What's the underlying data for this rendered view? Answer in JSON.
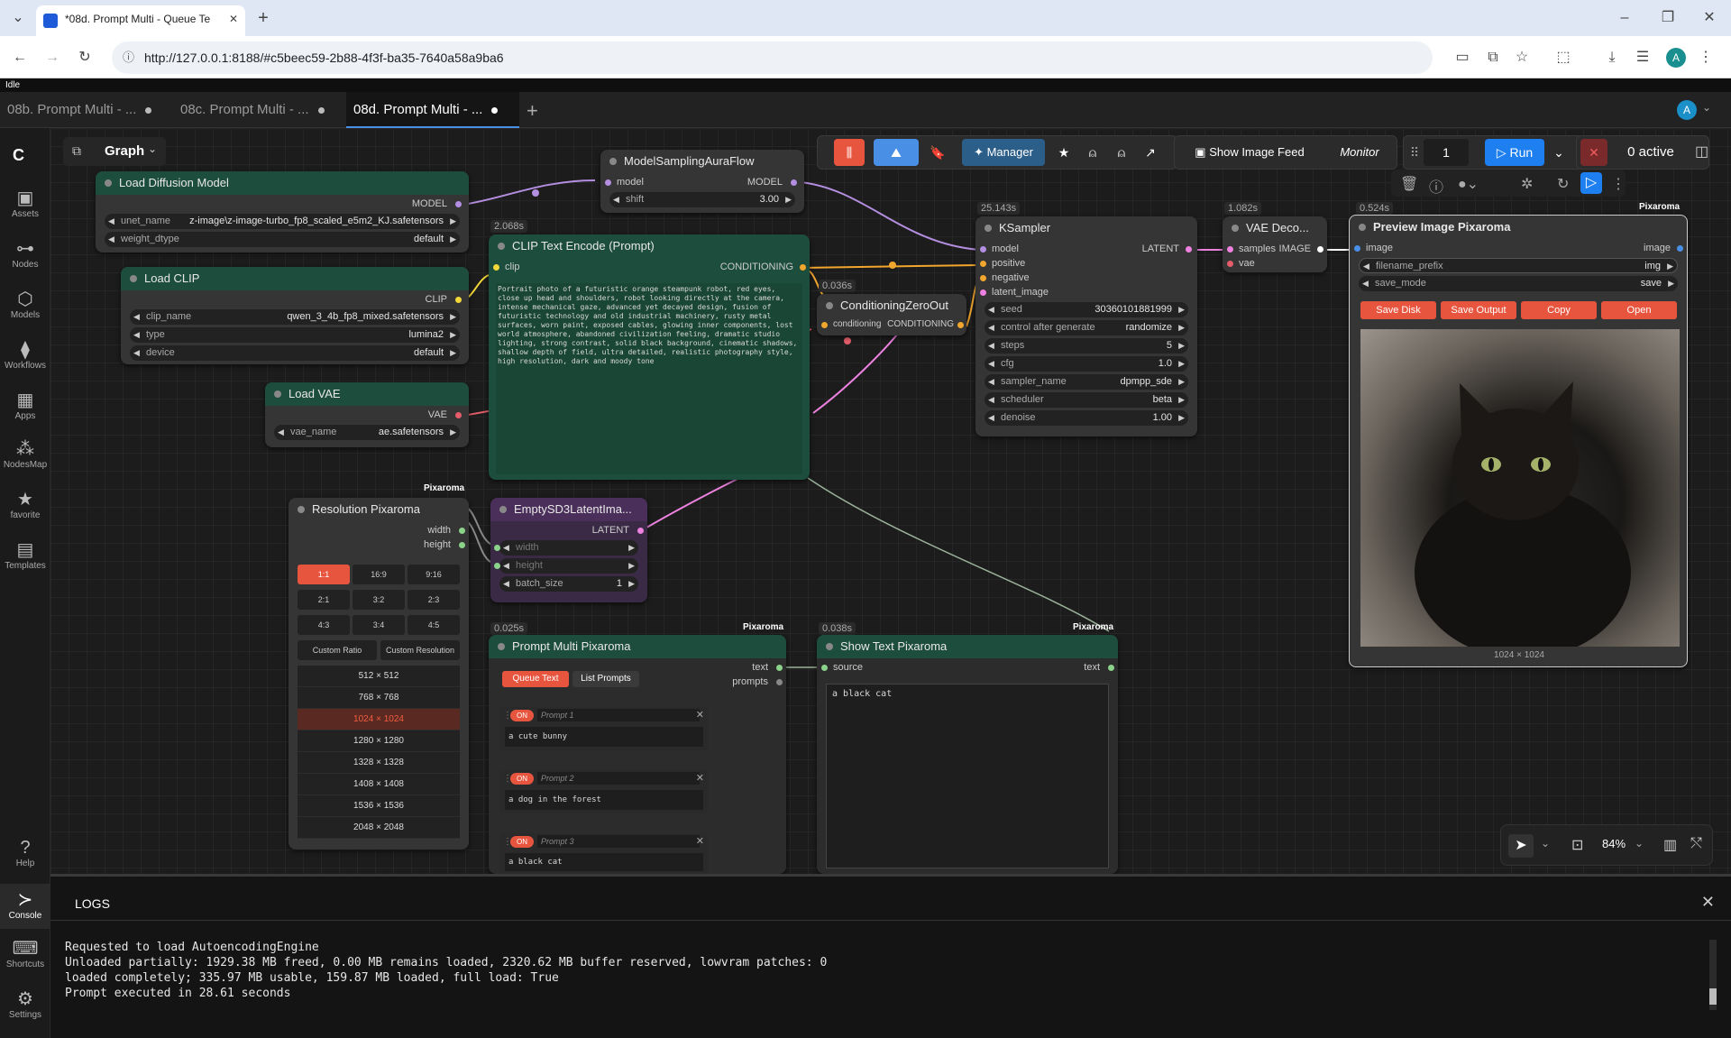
{
  "browser": {
    "tab_title": "*08d. Prompt Multi - Queue Te",
    "url": "http://127.0.0.1:8188/#c5beec59-2b88-4f3f-ba35-7640a58a9ba6",
    "avatar": "A"
  },
  "app": {
    "status": "Idle",
    "workflow_tabs": [
      {
        "label": "08b. Prompt Multi - ..."
      },
      {
        "label": "08c. Prompt Multi - ..."
      },
      {
        "label": "08d. Prompt Multi - ..."
      }
    ],
    "graph_label": "Graph",
    "avatar": "A"
  },
  "sidebar": {
    "items": [
      {
        "label": "Assets",
        "icon": "image-icon"
      },
      {
        "label": "Nodes",
        "icon": "link-icon"
      },
      {
        "label": "Models",
        "icon": "cube-icon"
      },
      {
        "label": "Workflows",
        "icon": "flow-icon"
      },
      {
        "label": "Apps",
        "icon": "grid-icon"
      },
      {
        "label": "NodesMap",
        "icon": "map-icon"
      },
      {
        "label": "favorite",
        "icon": "star-icon"
      },
      {
        "label": "Templates",
        "icon": "template-icon"
      },
      {
        "label": "Help",
        "icon": "help-icon"
      },
      {
        "label": "Console",
        "icon": "console-icon"
      },
      {
        "label": "Shortcuts",
        "icon": "keyboard-icon"
      },
      {
        "label": "Settings",
        "icon": "gear-icon"
      }
    ]
  },
  "toolbar": {
    "manager": "Manager",
    "show_image_feed": "Show Image Feed",
    "monitor": "Monitor",
    "queue_count": "1",
    "run": "Run",
    "active": "0 active",
    "zoom": "84%"
  },
  "nodes": {
    "load_diffusion": {
      "title": "Load Diffusion Model",
      "out": "MODEL",
      "unet_name_label": "unet_name",
      "unet_name": "z-image\\z-image-turbo_fp8_scaled_e5m2_KJ.safetensors",
      "weight_dtype_label": "weight_dtype",
      "weight_dtype": "default"
    },
    "load_clip": {
      "title": "Load CLIP",
      "out": "CLIP",
      "clip_name_label": "clip_name",
      "clip_name": "qwen_3_4b_fp8_mixed.safetensors",
      "type_label": "type",
      "type": "lumina2",
      "device_label": "device",
      "device": "default"
    },
    "load_vae": {
      "title": "Load VAE",
      "out": "VAE",
      "vae_name_label": "vae_name",
      "vae_name": "ae.safetensors"
    },
    "model_sampling": {
      "title": "ModelSamplingAuraFlow",
      "in": "model",
      "out": "MODEL",
      "shift_label": "shift",
      "shift": "3.00"
    },
    "clip_text": {
      "title": "CLIP Text Encode (Prompt)",
      "timing": "2.068s",
      "in": "clip",
      "out": "CONDITIONING",
      "text": "Portrait photo of a futuristic orange steampunk robot, red eyes, close up head and shoulders, robot looking directly at the camera, intense mechanical gaze, advanced yet decayed design, fusion of futuristic technology and old industrial machinery, rusty metal surfaces, worn paint, exposed cables, glowing inner components, lost world atmosphere, abandoned civilization feeling, dramatic studio lighting, strong contrast, solid black background, cinematic shadows, shallow depth of field, ultra detailed, realistic photography style, high resolution, dark and moody tone"
    },
    "cond_zero": {
      "title": "ConditioningZeroOut",
      "timing": "0.036s",
      "in": "conditioning",
      "out": "CONDITIONING"
    },
    "ksampler": {
      "title": "KSampler",
      "timing": "25.143s",
      "inputs": [
        "model",
        "positive",
        "negative",
        "latent_image"
      ],
      "out": "LATENT",
      "widgets": [
        {
          "label": "seed",
          "value": "30360101881999"
        },
        {
          "label": "control after generate",
          "value": "randomize"
        },
        {
          "label": "steps",
          "value": "5"
        },
        {
          "label": "cfg",
          "value": "1.0"
        },
        {
          "label": "sampler_name",
          "value": "dpmpp_sde"
        },
        {
          "label": "scheduler",
          "value": "beta"
        },
        {
          "label": "denoise",
          "value": "1.00"
        }
      ]
    },
    "vae_decode": {
      "title": "VAE Deco...",
      "timing": "1.082s",
      "inputs": [
        "samples",
        "vae"
      ],
      "out": "IMAGE"
    },
    "preview": {
      "title": "Preview Image Pixaroma",
      "timing": "0.524s",
      "badge": "Pixaroma",
      "in": "image",
      "out": "image",
      "filename_label": "filename_prefix",
      "filename": "img",
      "save_mode_label": "save_mode",
      "save_mode": "save",
      "buttons": [
        "Save Disk",
        "Save Output",
        "Copy",
        "Open"
      ],
      "dims": "1024 × 1024"
    },
    "resolution": {
      "title": "Resolution Pixaroma",
      "badge": "Pixaroma",
      "outs": [
        "width",
        "height"
      ],
      "ratios": [
        "1:1",
        "16:9",
        "9:16",
        "2:1",
        "3:2",
        "2:3",
        "4:3",
        "3:4",
        "4:5"
      ],
      "custom_ratio": "Custom Ratio",
      "custom_resolution": "Custom Resolution",
      "sizes": [
        "512 × 512",
        "768 × 768",
        "1024 × 1024",
        "1280 × 1280",
        "1328 × 1328",
        "1408 × 1408",
        "1536 × 1536",
        "2048 × 2048"
      ]
    },
    "empty_latent": {
      "title": "EmptySD3LatentIma...",
      "out": "LATENT",
      "width_label": "width",
      "height_label": "height",
      "batch_label": "batch_size",
      "batch": "1"
    },
    "prompt_multi": {
      "title": "Prompt Multi Pixaroma",
      "timing": "0.025s",
      "badge": "Pixaroma",
      "outs": [
        "text",
        "prompts"
      ],
      "queue_text": "Queue Text",
      "list_prompts": "List Prompts",
      "prompts": [
        {
          "on": "ON",
          "name": "Prompt 1",
          "text": "a cute bunny"
        },
        {
          "on": "ON",
          "name": "Prompt 2",
          "text": "a dog in the forest"
        },
        {
          "on": "ON",
          "name": "Prompt 3",
          "text": "a black cat"
        }
      ]
    },
    "show_text": {
      "title": "Show Text Pixaroma",
      "timing": "0.038s",
      "badge": "Pixaroma",
      "in": "source",
      "out": "text",
      "text": "a black cat"
    }
  },
  "logs": {
    "title": "LOGS",
    "lines": [
      "Requested to load AutoencodingEngine",
      "Unloaded partially: 1929.38 MB freed, 0.00 MB remains loaded, 2320.62 MB buffer reserved, lowvram patches: 0",
      "loaded completely; 335.97 MB usable, 159.87 MB loaded, full load: True",
      "Prompt executed in 28.61 seconds"
    ]
  }
}
